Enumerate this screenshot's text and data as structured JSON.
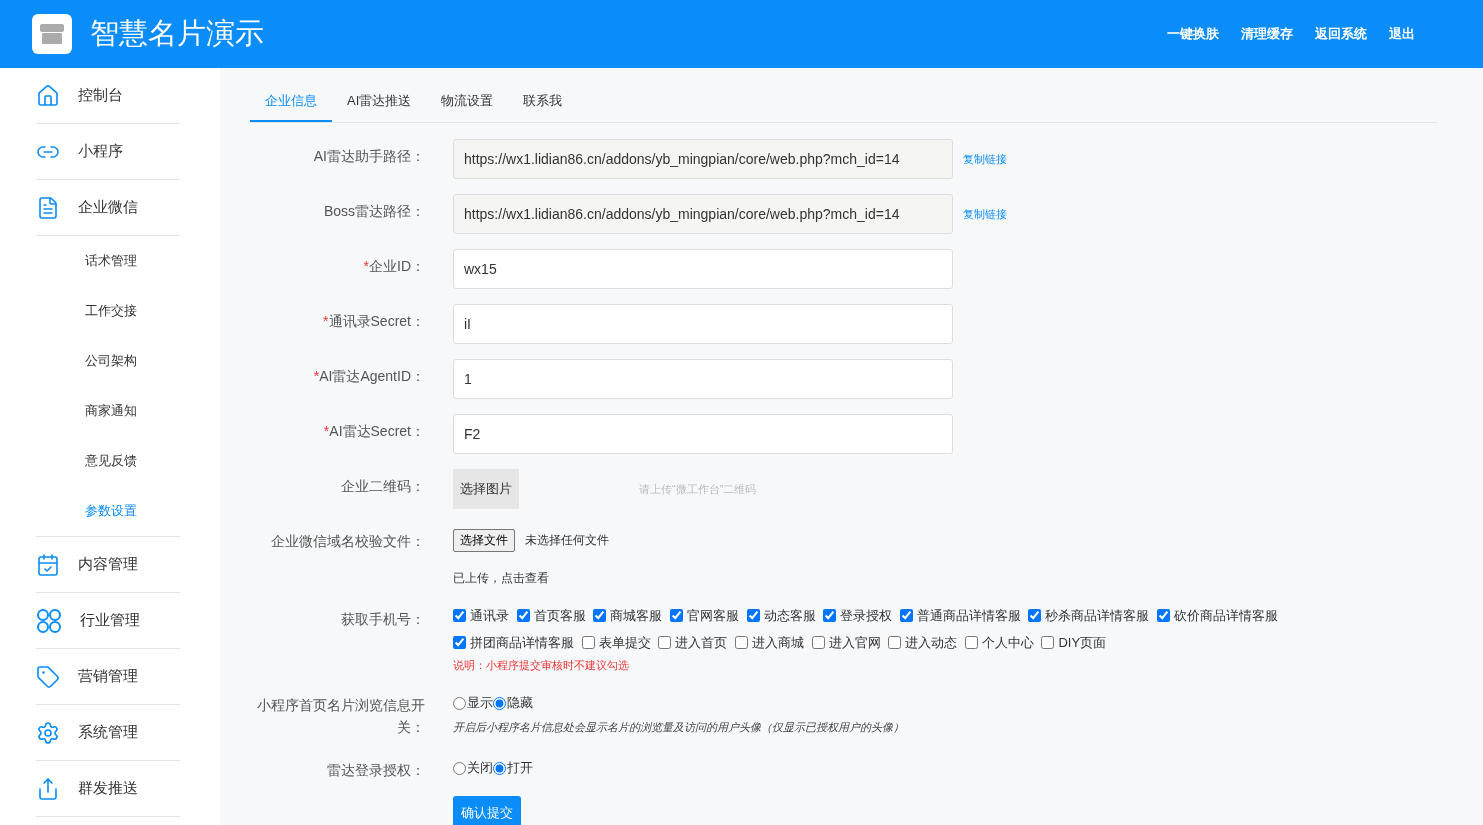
{
  "header": {
    "title": "智慧名片演示",
    "links": [
      "一键换肤",
      "清理缓存",
      "返回系统",
      "退出"
    ]
  },
  "sidebar": {
    "items": [
      {
        "label": "控制台",
        "selected": false
      },
      {
        "label": "小程序",
        "selected": false
      },
      {
        "label": "企业微信",
        "selected": false,
        "children": [
          {
            "label": "话术管理",
            "selected": false
          },
          {
            "label": "工作交接",
            "selected": false
          },
          {
            "label": "公司架构",
            "selected": false
          },
          {
            "label": "商家通知",
            "selected": false
          },
          {
            "label": "意见反馈",
            "selected": false
          },
          {
            "label": "参数设置",
            "selected": true
          }
        ]
      },
      {
        "label": "内容管理",
        "selected": false
      },
      {
        "label": "行业管理",
        "selected": false
      },
      {
        "label": "营销管理",
        "selected": false
      },
      {
        "label": "系统管理",
        "selected": false
      },
      {
        "label": "群发推送",
        "selected": false
      }
    ]
  },
  "tabs": [
    {
      "label": "企业信息",
      "selected": true
    },
    {
      "label": "AI雷达推送",
      "selected": false
    },
    {
      "label": "物流设置",
      "selected": false
    },
    {
      "label": "联系我",
      "selected": false
    }
  ],
  "form": [
    {
      "kind": "readonly",
      "label": "AI雷达助手路径：",
      "value": "https://wx1.lidian86.cn/addons/yb_mingpian/core/web.php?mch_id=14",
      "action": "复制链接"
    },
    {
      "kind": "readonly",
      "label": "Boss雷达路径：",
      "value": "https://wx1.lidian86.cn/addons/yb_mingpian/core/web.php?mch_id=14",
      "action": "复制链接"
    },
    {
      "kind": "input",
      "mark": "*",
      "label": "企业ID：",
      "value": "wx15"
    },
    {
      "kind": "input",
      "mark": "*",
      "label": "通讯录Secret：",
      "value": "iI"
    },
    {
      "kind": "input",
      "mark": "*",
      "label": "AI雷达AgentID：",
      "value": "1"
    },
    {
      "kind": "input",
      "mark": "*",
      "label": "AI雷达Secret：",
      "value": "F2"
    },
    {
      "kind": "image",
      "label": "企业二维码：",
      "button": "选择图片",
      "hint": "请上传“微工作台”二维码"
    },
    {
      "kind": "file",
      "label": "企业微信域名校验文件：",
      "button": "选择文件",
      "status": "未选择任何文件",
      "note": "已上传，点击查看"
    },
    {
      "kind": "checks",
      "label": "获取手机号：",
      "options": [
        {
          "label": "通讯录",
          "checked": true
        },
        {
          "label": "首页客服",
          "checked": true
        },
        {
          "label": "商城客服",
          "checked": true
        },
        {
          "label": "官网客服",
          "checked": true
        },
        {
          "label": "动态客服",
          "checked": true
        },
        {
          "label": "登录授权",
          "checked": true
        },
        {
          "label": "普通商品详情客服",
          "checked": true
        },
        {
          "label": "秒杀商品详情客服",
          "checked": true
        },
        {
          "label": "砍价商品详情客服",
          "checked": true
        },
        {
          "label": "拼团商品详情客服",
          "checked": true
        },
        {
          "label": "表单提交",
          "checked": false
        },
        {
          "label": "进入首页",
          "checked": false
        },
        {
          "label": "进入商城",
          "checked": false
        },
        {
          "label": "进入官网",
          "checked": false
        },
        {
          "label": "进入动态",
          "checked": false
        },
        {
          "label": "个人中心",
          "checked": false
        },
        {
          "label": "DIY页面",
          "checked": false
        }
      ],
      "warning": "说明：小程序提交审核时不建议勾选"
    },
    {
      "kind": "radios",
      "label": "小程序首页名片浏览信息开关：",
      "options": [
        {
          "label": "显示",
          "selected": false
        },
        {
          "label": "隐藏",
          "selected": true
        }
      ],
      "note": "开启后小程序名片信息处会显示名片的浏览量及访问的用户头像（仅显示已授权用户的头像）"
    },
    {
      "kind": "radios",
      "label": "雷达登录授权：",
      "options": [
        {
          "label": "关闭",
          "selected": false
        },
        {
          "label": "打开",
          "selected": true
        }
      ]
    }
  ],
  "submit": "确认提交"
}
